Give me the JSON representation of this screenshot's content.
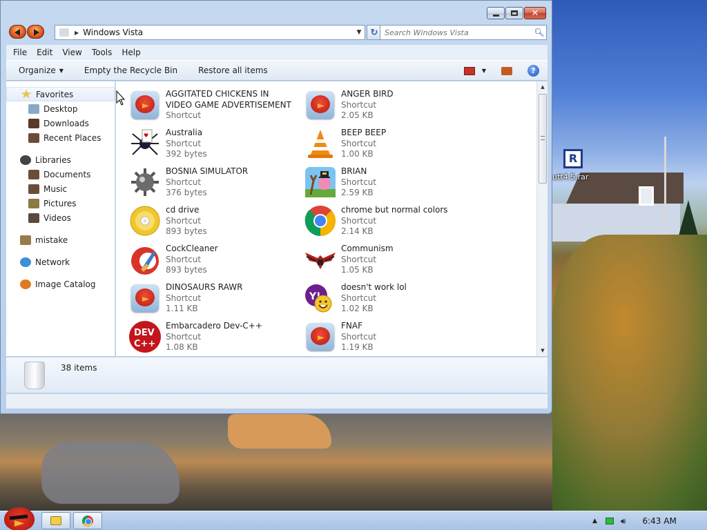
{
  "window": {
    "address_path": "Windows Vista",
    "search_placeholder": "Search Windows Vista"
  },
  "menubar": [
    "File",
    "Edit",
    "View",
    "Tools",
    "Help"
  ],
  "commandbar": {
    "organize": "Organize",
    "empty_bin": "Empty the Recycle Bin",
    "restore_all": "Restore all items"
  },
  "navpane": {
    "favorites": "Favorites",
    "desktop": "Desktop",
    "downloads": "Downloads",
    "recent": "Recent Places",
    "libraries": "Libraries",
    "documents": "Documents",
    "music": "Music",
    "pictures": "Pictures",
    "videos": "Videos",
    "mistake": "mistake",
    "network": "Network",
    "image_catalog": "Image Catalog"
  },
  "items": [
    {
      "name": "AGGITATED CHICKENS IN VIDEO GAME ADVERTISEMENT",
      "type": "Shortcut",
      "size": "",
      "icon": "angry-bird-rio-icon"
    },
    {
      "name": "ANGER BIRD",
      "type": "Shortcut",
      "size": "2.05 KB",
      "icon": "angry-bird-icon"
    },
    {
      "name": "Australia",
      "type": "Shortcut",
      "size": "392 bytes",
      "icon": "spider-solitaire-icon"
    },
    {
      "name": "BEEP BEEP",
      "type": "Shortcut",
      "size": "1.00 KB",
      "icon": "vlc-cone-icon"
    },
    {
      "name": "BOSNIA SIMULATOR",
      "type": "Shortcut",
      "size": "376 bytes",
      "icon": "minesweeper-mine-icon"
    },
    {
      "name": "BRIAN",
      "type": "Shortcut",
      "size": "2.59 KB",
      "icon": "angry-bird-slingshot-icon"
    },
    {
      "name": "cd drive",
      "type": "Shortcut",
      "size": "893 bytes",
      "icon": "cd-disc-icon"
    },
    {
      "name": "chrome but normal colors",
      "type": "Shortcut",
      "size": "2.14 KB",
      "icon": "chrome-icon"
    },
    {
      "name": "CockCleaner",
      "type": "Shortcut",
      "size": "893 bytes",
      "icon": "ccleaner-icon"
    },
    {
      "name": "Communism",
      "type": "Shortcut",
      "size": "1.05 KB",
      "icon": "eagle-emblem-icon"
    },
    {
      "name": "DINOSAURS RAWR",
      "type": "Shortcut",
      "size": "1.11 KB",
      "icon": "angry-bird-icon"
    },
    {
      "name": "doesn't work lol",
      "type": "Shortcut",
      "size": "1.02 KB",
      "icon": "yahoo-messenger-icon"
    },
    {
      "name": "Embarcadero Dev-C++",
      "type": "Shortcut",
      "size": "1.08 KB",
      "icon": "dev-cpp-icon"
    },
    {
      "name": "FNAF",
      "type": "Shortcut",
      "size": "1.19 KB",
      "icon": "angry-bird-icon"
    }
  ],
  "details": {
    "count": "38 items"
  },
  "desktop_icon": {
    "label": "utt4.5.rar",
    "glyph": "R"
  },
  "taskbar": {
    "clock": "6:43 AM"
  },
  "dev_label_1": "DEV",
  "dev_label_2": "C++",
  "yahoo_letter": "Y!",
  "colors": {
    "accent": "#2c62b0",
    "window_frame": "#c4d8f0"
  }
}
